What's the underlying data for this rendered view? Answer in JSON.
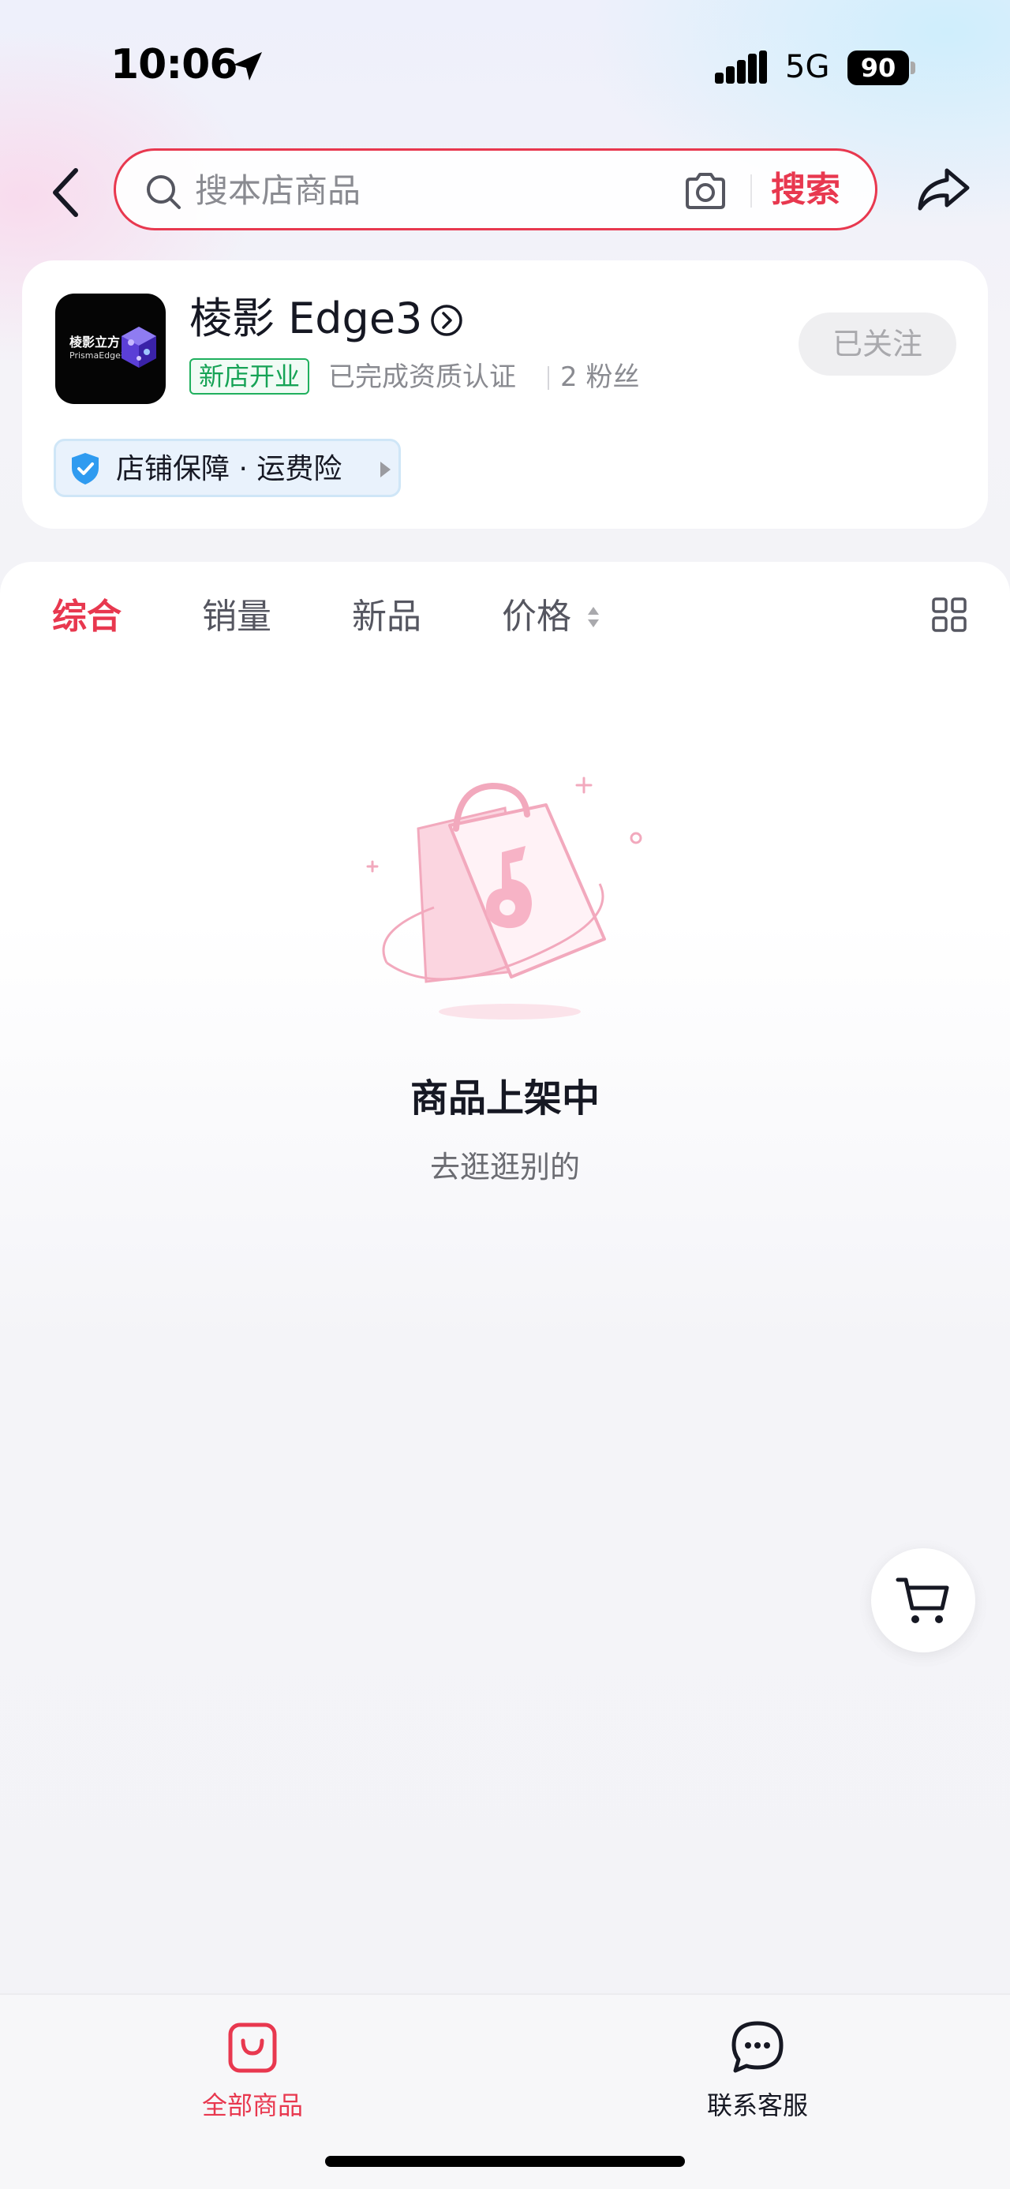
{
  "status_bar": {
    "time": "10:06",
    "network": "5G",
    "battery": "90"
  },
  "header": {
    "search_placeholder": "搜本店商品",
    "search_button": "搜索"
  },
  "shop": {
    "logo_cn": "棱影立方",
    "logo_en": "PrismaEdge³",
    "name": "棱影 Edge3",
    "badge": "新店开业",
    "verification": "已完成资质认证",
    "fans": "2 粉丝",
    "follow_button": "已关注",
    "guarantee": "店铺保障 · 运费险"
  },
  "tabs": [
    {
      "label": "综合",
      "active": true
    },
    {
      "label": "销量",
      "active": false
    },
    {
      "label": "新品",
      "active": false
    },
    {
      "label": "价格",
      "active": false
    }
  ],
  "empty_state": {
    "title": "商品上架中",
    "subtitle": "去逛逛别的"
  },
  "bottom_nav": [
    {
      "label": "全部商品",
      "icon": "shopping-bag-icon",
      "active": true
    },
    {
      "label": "联系客服",
      "icon": "chat-bubble-icon",
      "active": false
    }
  ],
  "colors": {
    "accent": "#e8384f",
    "green_badge": "#17a356",
    "text_primary": "#161823",
    "text_secondary": "#8a8b91"
  }
}
